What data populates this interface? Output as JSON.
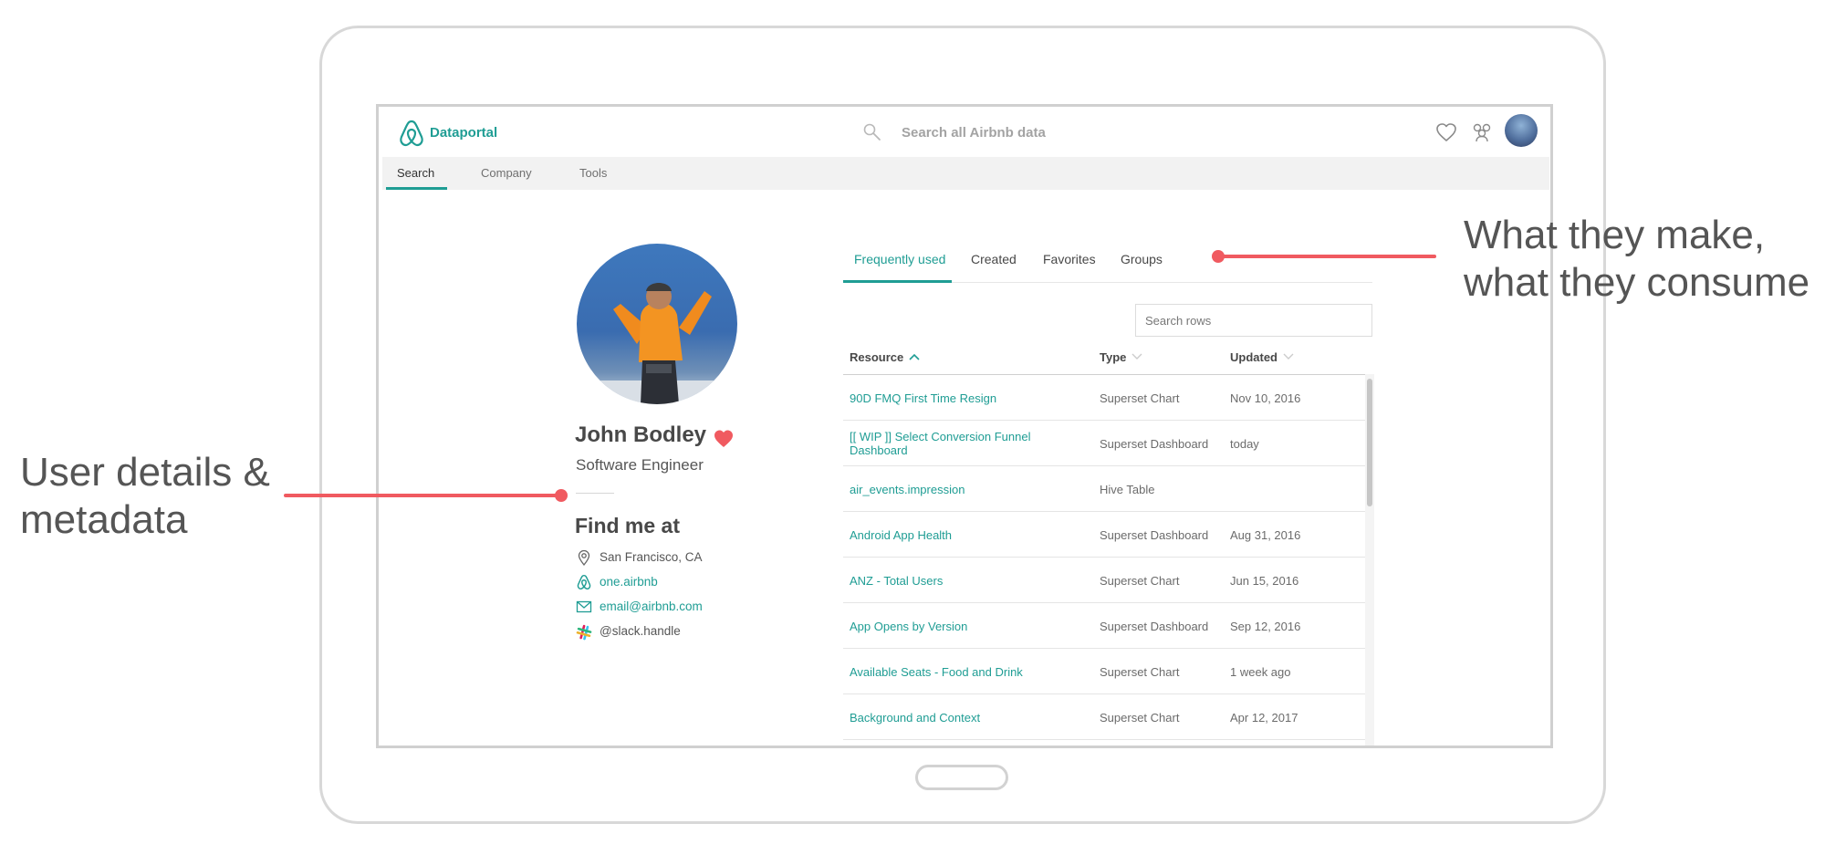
{
  "app": {
    "brand": "Dataportal",
    "search_placeholder": "Search all Airbnb data"
  },
  "nav": {
    "tabs": [
      "Search",
      "Company",
      "Tools"
    ],
    "active": "Search"
  },
  "profile": {
    "name": "John Bodley",
    "title": "Software Engineer",
    "find_me_heading": "Find me at",
    "contacts": [
      {
        "icon": "location-pin-icon",
        "text": "San Francisco, CA",
        "link": false
      },
      {
        "icon": "airbnb-logo-icon",
        "text": "one.airbnb",
        "link": true
      },
      {
        "icon": "envelope-icon",
        "text": "email@airbnb.com",
        "link": true
      },
      {
        "icon": "slack-icon",
        "text": "@slack.handle",
        "link": false
      }
    ]
  },
  "resource_tabs": [
    "Frequently used",
    "Created",
    "Favorites",
    "Groups"
  ],
  "active_resource_tab": "Frequently used",
  "table": {
    "search_placeholder": "Search rows",
    "headers": {
      "resource": "Resource",
      "type": "Type",
      "updated": "Updated"
    },
    "rows": [
      {
        "resource": "90D FMQ First Time Resign",
        "type": "Superset Chart",
        "updated": "Nov 10, 2016"
      },
      {
        "resource": "[[ WIP ]] Select Conversion Funnel Dashboard",
        "type": "Superset Dashboard",
        "updated": "today"
      },
      {
        "resource": "air_events.impression",
        "type": "Hive Table",
        "updated": ""
      },
      {
        "resource": "Android App Health",
        "type": "Superset Dashboard",
        "updated": "Aug 31, 2016"
      },
      {
        "resource": "ANZ - Total Users",
        "type": "Superset Chart",
        "updated": "Jun 15, 2016"
      },
      {
        "resource": "App Opens by Version",
        "type": "Superset Dashboard",
        "updated": "Sep 12, 2016"
      },
      {
        "resource": "Available Seats - Food and Drink",
        "type": "Superset Chart",
        "updated": "1 week ago"
      },
      {
        "resource": "Background and Context",
        "type": "Superset Chart",
        "updated": "Apr 12, 2017"
      }
    ]
  },
  "callouts": {
    "right_line1": "What they make,",
    "right_line2": "what they consume",
    "left_line1": "User details &",
    "left_line2": "metadata"
  },
  "colors": {
    "accent": "#1f9d94",
    "callout": "#f05a60",
    "heart": "#f05a60"
  }
}
